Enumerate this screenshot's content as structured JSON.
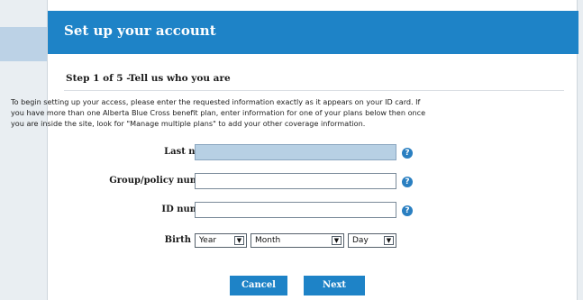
{
  "header": {
    "title": "Set up your account"
  },
  "step": {
    "title": "Step 1 of 5 -Tell us who you are"
  },
  "intro_lines": [
    "To begin setting up your access, please enter the requested information exactly as it appears on your ID card. If",
    "you have more than one Alberta Blue Cross benefit plan, enter information for one of your plans below then once",
    "you are inside the site, look for \"Manage multiple plans\" to add your other coverage information."
  ],
  "form": {
    "last_name_label": "Last name",
    "group_policy_label": "Group/policy number",
    "id_number_label": "ID number",
    "birth_date_label": "Birth date",
    "help_glyph": "?",
    "year_select": "Year",
    "month_select": "Month",
    "day_select": "Day",
    "select_arrow_glyph": "▼"
  },
  "buttons": {
    "cancel": "Cancel",
    "next": "Next"
  },
  "colors": {
    "header": "#1e83c7",
    "highlight_field": "#b7d0e4"
  }
}
